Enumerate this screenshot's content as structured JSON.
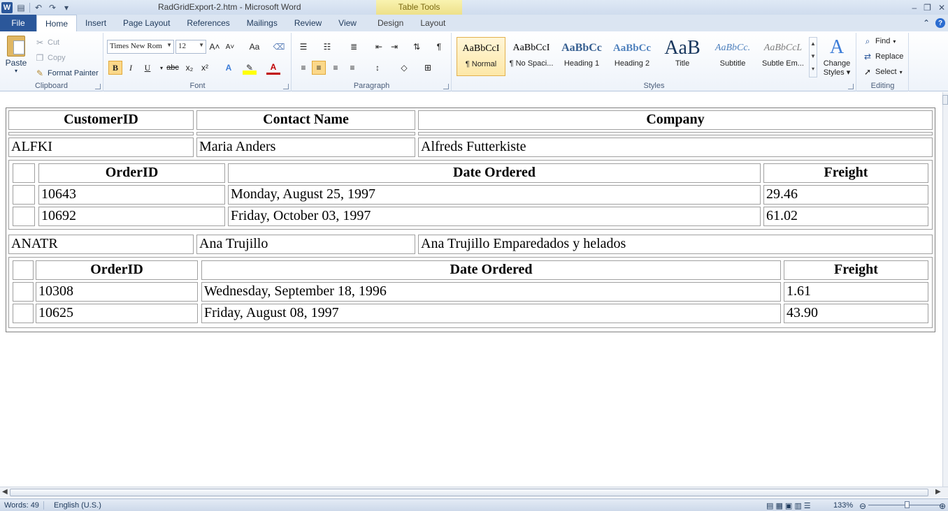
{
  "window": {
    "title": "RadGridExport-2.htm  -  Microsoft Word",
    "contextual_tab_group": "Table Tools",
    "minimize": "–",
    "restore": "❐",
    "close": "✕",
    "qat_undo": "↶",
    "qat_redo": "↷",
    "qat_save": "▤",
    "qat_more": "▾",
    "logo": "W"
  },
  "tabs": [
    {
      "label": "File"
    },
    {
      "label": "Home"
    },
    {
      "label": "Insert"
    },
    {
      "label": "Page Layout"
    },
    {
      "label": "References"
    },
    {
      "label": "Mailings"
    },
    {
      "label": "Review"
    },
    {
      "label": "View"
    },
    {
      "label": "Design"
    },
    {
      "label": "Layout"
    }
  ],
  "ribbon": {
    "clipboard": {
      "label": "Clipboard",
      "paste": "Paste",
      "cut": "Cut",
      "copy": "Copy",
      "format_painter": "Format Painter"
    },
    "font": {
      "label": "Font",
      "font_name": "Times New Rom",
      "font_size": "12",
      "grow": "A˄",
      "shrink": "A˅",
      "change_case": "Aa",
      "bold": "B",
      "italic": "I",
      "underline": "U",
      "strike": "abc",
      "subscript": "x₂",
      "superscript": "x²",
      "font_color": "A"
    },
    "paragraph": {
      "label": "Paragraph",
      "pilcrow": "¶"
    },
    "styles": {
      "label": "Styles",
      "items": [
        {
          "sample": "AaBbCcI",
          "name": "¶ Normal"
        },
        {
          "sample": "AaBbCcI",
          "name": "¶ No Spaci..."
        },
        {
          "sample": "AaBbCc",
          "name": "Heading 1"
        },
        {
          "sample": "AaBbCc",
          "name": "Heading 2"
        },
        {
          "sample": "AaB",
          "name": "Title"
        },
        {
          "sample": "AaBbCc.",
          "name": "Subtitle"
        },
        {
          "sample": "AaBbCcL",
          "name": "Subtle Em..."
        }
      ],
      "change_styles": "Change",
      "change_styles_2": "Styles"
    },
    "editing": {
      "label": "Editing",
      "find": "Find",
      "replace": "Replace",
      "select": "Select"
    }
  },
  "grid": {
    "master_headers": [
      "CustomerID",
      "Contact Name",
      "Company"
    ],
    "detail_headers": [
      "OrderID",
      "Date Ordered",
      "Freight"
    ],
    "customers": [
      {
        "id": "ALFKI",
        "contact": "Maria Anders",
        "company": "Alfreds Futterkiste",
        "orders": [
          {
            "id": "10643",
            "date": "Monday, August 25, 1997",
            "freight": "29.46"
          },
          {
            "id": "10692",
            "date": "Friday, October 03, 1997",
            "freight": "61.02"
          }
        ]
      },
      {
        "id": "ANATR",
        "contact": "Ana Trujillo",
        "company": "Ana Trujillo Emparedados y helados",
        "orders": [
          {
            "id": "10308",
            "date": "Wednesday, September 18, 1996",
            "freight": "1.61"
          },
          {
            "id": "10625",
            "date": "Friday, August 08, 1997",
            "freight": "43.90"
          }
        ]
      }
    ]
  },
  "status": {
    "words": "Words: 49",
    "language": "English (U.S.)",
    "zoom": "133%"
  }
}
